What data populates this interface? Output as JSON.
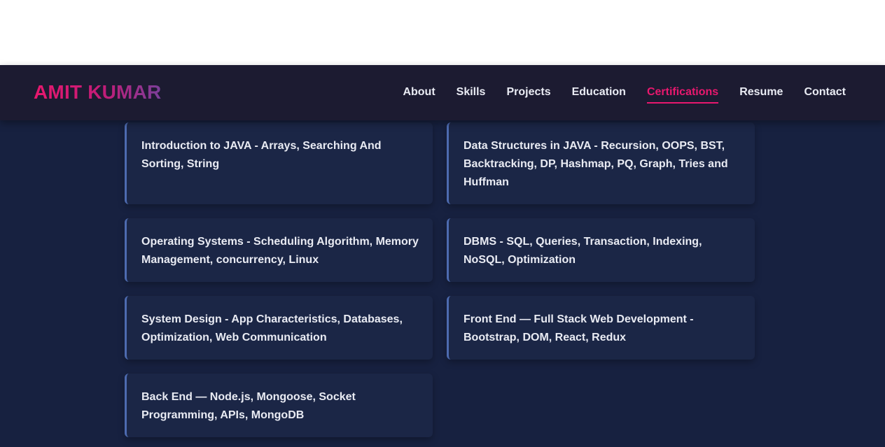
{
  "header": {
    "brand": "AMIT KUMAR",
    "nav": [
      {
        "label": "About",
        "active": false
      },
      {
        "label": "Skills",
        "active": false
      },
      {
        "label": "Projects",
        "active": false
      },
      {
        "label": "Education",
        "active": false
      },
      {
        "label": "Certifications",
        "active": true
      },
      {
        "label": "Resume",
        "active": false
      },
      {
        "label": "Contact",
        "active": false
      }
    ]
  },
  "certifications": [
    {
      "title": "Introduction to JAVA - Arrays, Searching And Sorting, String"
    },
    {
      "title": "Data Structures in JAVA - Recursion, OOPS, BST, Backtracking, DP, Hashmap, PQ, Graph, Tries and Huffman"
    },
    {
      "title": "Operating Systems - Scheduling Algorithm, Memory Management, concurrency, Linux"
    },
    {
      "title": "DBMS - SQL, Queries, Transaction, Indexing, NoSQL, Optimization"
    },
    {
      "title": "System Design - App Characteristics, Databases, Optimization, Web Communication"
    },
    {
      "title": "Front End — Full Stack Web Development - Bootstrap, DOM, React, Redux"
    },
    {
      "title": "Back End — Node.js, Mongoose, Socket Programming, APIs, MongoDB"
    }
  ],
  "colors": {
    "accent": "#e8186e",
    "navbar_bg": "#1c1b31",
    "page_bg": "#172140",
    "card_bg": "#1b2646",
    "card_border": "#4d6bb0",
    "text": "#e9ebf3"
  }
}
